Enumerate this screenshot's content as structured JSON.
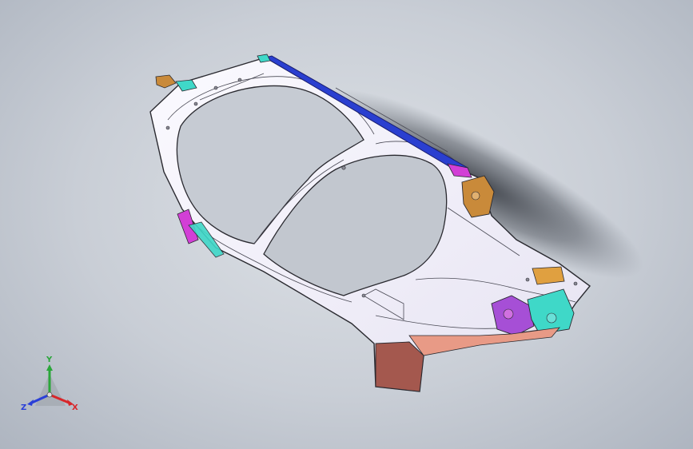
{
  "viewport": {
    "background_top": "#dde1e6",
    "background_bottom": "#aeb5c0"
  },
  "model": {
    "body_color": "#f4f2fb",
    "edge_color": "#2a2a30",
    "top_rail_color": "#2a3fd0",
    "parts": [
      {
        "name": "bracket-magenta",
        "color": "#d23fd6"
      },
      {
        "name": "bracket-cyan",
        "color": "#3fd8c8"
      },
      {
        "name": "bracket-brown",
        "color": "#a4584e"
      },
      {
        "name": "bracket-orange",
        "color": "#c98a3a"
      },
      {
        "name": "bracket-purple",
        "color": "#8c3fd6"
      }
    ]
  },
  "triad": {
    "x_label": "X",
    "y_label": "Y",
    "z_label": "Z",
    "x_color": "#d8262a",
    "y_color": "#2aa63a",
    "z_color": "#2a3fd8"
  }
}
